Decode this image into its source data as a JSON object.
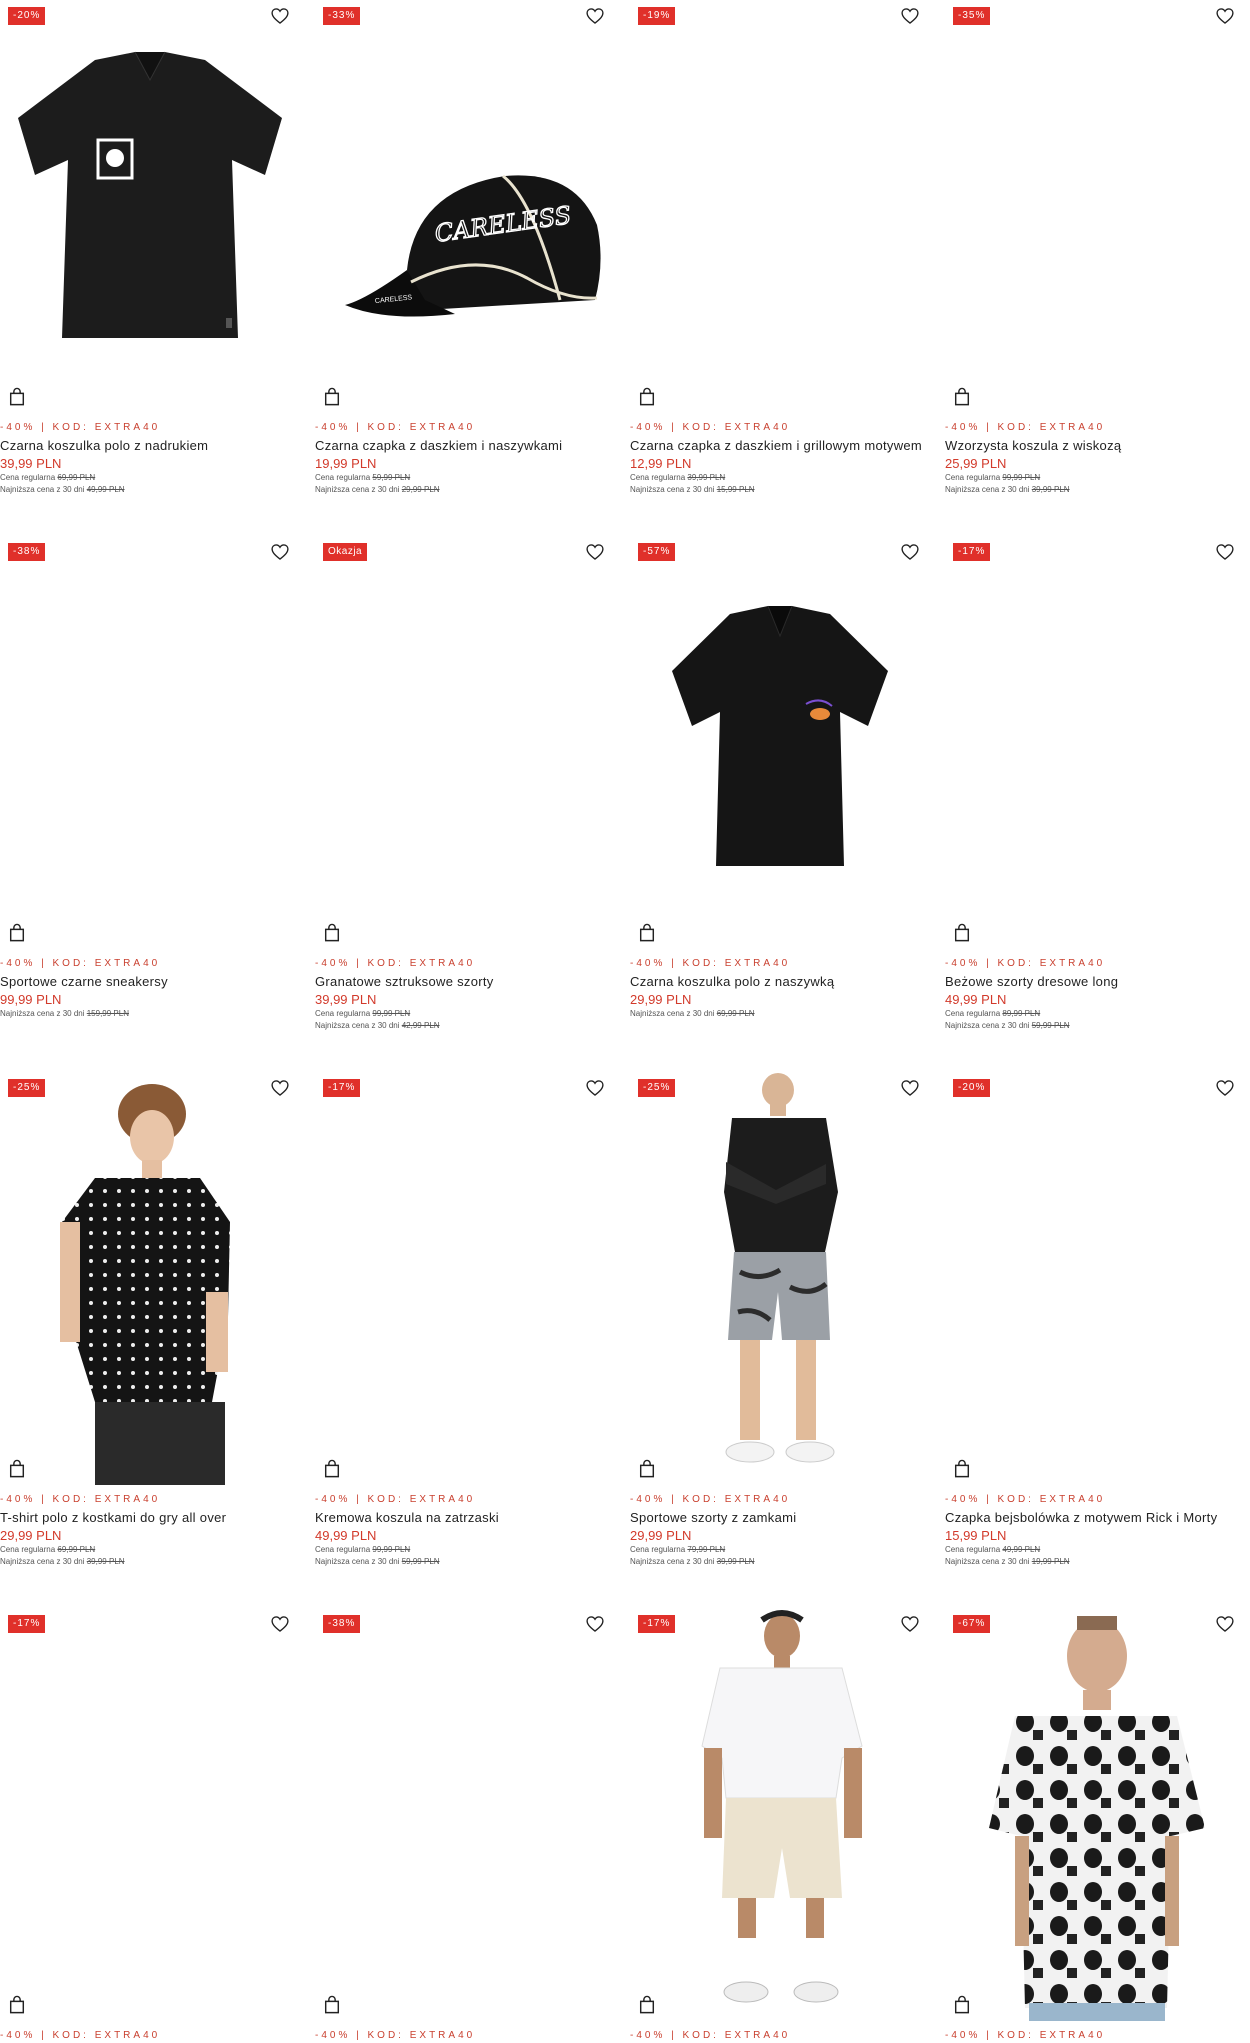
{
  "colors": {
    "accent": "#e0302a",
    "price": "#d23a2b",
    "promo": "#c9402f"
  },
  "products": [
    {
      "badge": "-20%",
      "promo": "-40% | KOD: EXTRA40",
      "name": "Czarna koszulka polo z nadrukiem",
      "price": "39,99 PLN",
      "regular_label": "Cena regularna",
      "regular_price": "69,99 PLN",
      "lowest_label": "Najniższa cena z 30 dni",
      "lowest_price": "49,99 PLN",
      "image": "black-polo-print"
    },
    {
      "badge": "-33%",
      "promo": "-40% | KOD: EXTRA40",
      "name": "Czarna czapka z daszkiem i naszywkami",
      "price": "19,99 PLN",
      "regular_label": "Cena regularna",
      "regular_price": "59,99 PLN",
      "lowest_label": "Najniższa cena z 30 dni",
      "lowest_price": "29,99 PLN",
      "image": "black-cap"
    },
    {
      "badge": "-19%",
      "promo": "-40% | KOD: EXTRA40",
      "name": "Czarna czapka z daszkiem i grillowym motywem",
      "price": "12,99 PLN",
      "regular_label": "Cena regularna",
      "regular_price": "39,99 PLN",
      "lowest_label": "Najniższa cena z 30 dni",
      "lowest_price": "15,99 PLN",
      "image": ""
    },
    {
      "badge": "-35%",
      "promo": "-40% | KOD: EXTRA40",
      "name": "Wzorzysta koszula z wiskozą",
      "price": "25,99 PLN",
      "regular_label": "Cena regularna",
      "regular_price": "99,99 PLN",
      "lowest_label": "Najniższa cena z 30 dni",
      "lowest_price": "39,99 PLN",
      "image": ""
    },
    {
      "badge": "-38%",
      "promo": "-40% | KOD: EXTRA40",
      "name": "Sportowe czarne sneakersy",
      "price": "99,99 PLN",
      "regular_label": "",
      "regular_price": "",
      "lowest_label": "Najniższa cena z 30 dni",
      "lowest_price": "159,99 PLN",
      "image": ""
    },
    {
      "badge": "Okazja",
      "promo": "-40% | KOD: EXTRA40",
      "name": "Granatowe sztruksowe szorty",
      "price": "39,99 PLN",
      "regular_label": "Cena regularna",
      "regular_price": "99,99 PLN",
      "lowest_label": "Najniższa cena z 30 dni",
      "lowest_price": "42,99 PLN",
      "image": ""
    },
    {
      "badge": "-57%",
      "promo": "-40% | KOD: EXTRA40",
      "name": "Czarna koszulka polo z naszywką",
      "price": "29,99 PLN",
      "regular_label": "",
      "regular_price": "",
      "lowest_label": "Najniższa cena z 30 dni",
      "lowest_price": "69,99 PLN",
      "image": "black-polo-patch"
    },
    {
      "badge": "-17%",
      "promo": "-40% | KOD: EXTRA40",
      "name": "Beżowe szorty dresowe long",
      "price": "49,99 PLN",
      "regular_label": "Cena regularna",
      "regular_price": "89,99 PLN",
      "lowest_label": "Najniższa cena z 30 dni",
      "lowest_price": "59,99 PLN",
      "image": ""
    },
    {
      "badge": "-25%",
      "promo": "-40% | KOD: EXTRA40",
      "name": "T-shirt polo z kostkami do gry all over",
      "price": "29,99 PLN",
      "regular_label": "Cena regularna",
      "regular_price": "69,99 PLN",
      "lowest_label": "Najniższa cena z 30 dni",
      "lowest_price": "39,99 PLN",
      "image": "model-dotted-polo"
    },
    {
      "badge": "-17%",
      "promo": "-40% | KOD: EXTRA40",
      "name": "Kremowa koszula na zatrzaski",
      "price": "49,99 PLN",
      "regular_label": "Cena regularna",
      "regular_price": "99,99 PLN",
      "lowest_label": "Najniższa cena z 30 dni",
      "lowest_price": "59,99 PLN",
      "image": ""
    },
    {
      "badge": "-25%",
      "promo": "-40% | KOD: EXTRA40",
      "name": "Sportowe szorty z zamkami",
      "price": "29,99 PLN",
      "regular_label": "Cena regularna",
      "regular_price": "79,99 PLN",
      "lowest_label": "Najniższa cena z 30 dni",
      "lowest_price": "39,99 PLN",
      "image": "model-shorts"
    },
    {
      "badge": "-20%",
      "promo": "-40% | KOD: EXTRA40",
      "name": "Czapka bejsbolówka z motywem Rick i Morty",
      "price": "15,99 PLN",
      "regular_label": "Cena regularna",
      "regular_price": "49,99 PLN",
      "lowest_label": "Najniższa cena z 30 dni",
      "lowest_price": "19,99 PLN",
      "image": ""
    },
    {
      "badge": "-17%",
      "promo": "-40% | KOD: EXTRA40",
      "name": "",
      "price": "",
      "regular_label": "",
      "regular_price": "",
      "lowest_label": "",
      "lowest_price": "",
      "image": ""
    },
    {
      "badge": "-38%",
      "promo": "-40% | KOD: EXTRA40",
      "name": "",
      "price": "",
      "regular_label": "",
      "regular_price": "",
      "lowest_label": "",
      "lowest_price": "",
      "image": ""
    },
    {
      "badge": "-17%",
      "promo": "-40% | KOD: EXTRA40",
      "name": "",
      "price": "",
      "regular_label": "",
      "regular_price": "",
      "lowest_label": "",
      "lowest_price": "",
      "image": "model-white-shirt"
    },
    {
      "badge": "-67%",
      "promo": "-40% | KOD: EXTRA40",
      "name": "",
      "price": "",
      "regular_label": "",
      "regular_price": "",
      "lowest_label": "",
      "lowest_price": "",
      "image": "model-printed-shirt"
    }
  ]
}
